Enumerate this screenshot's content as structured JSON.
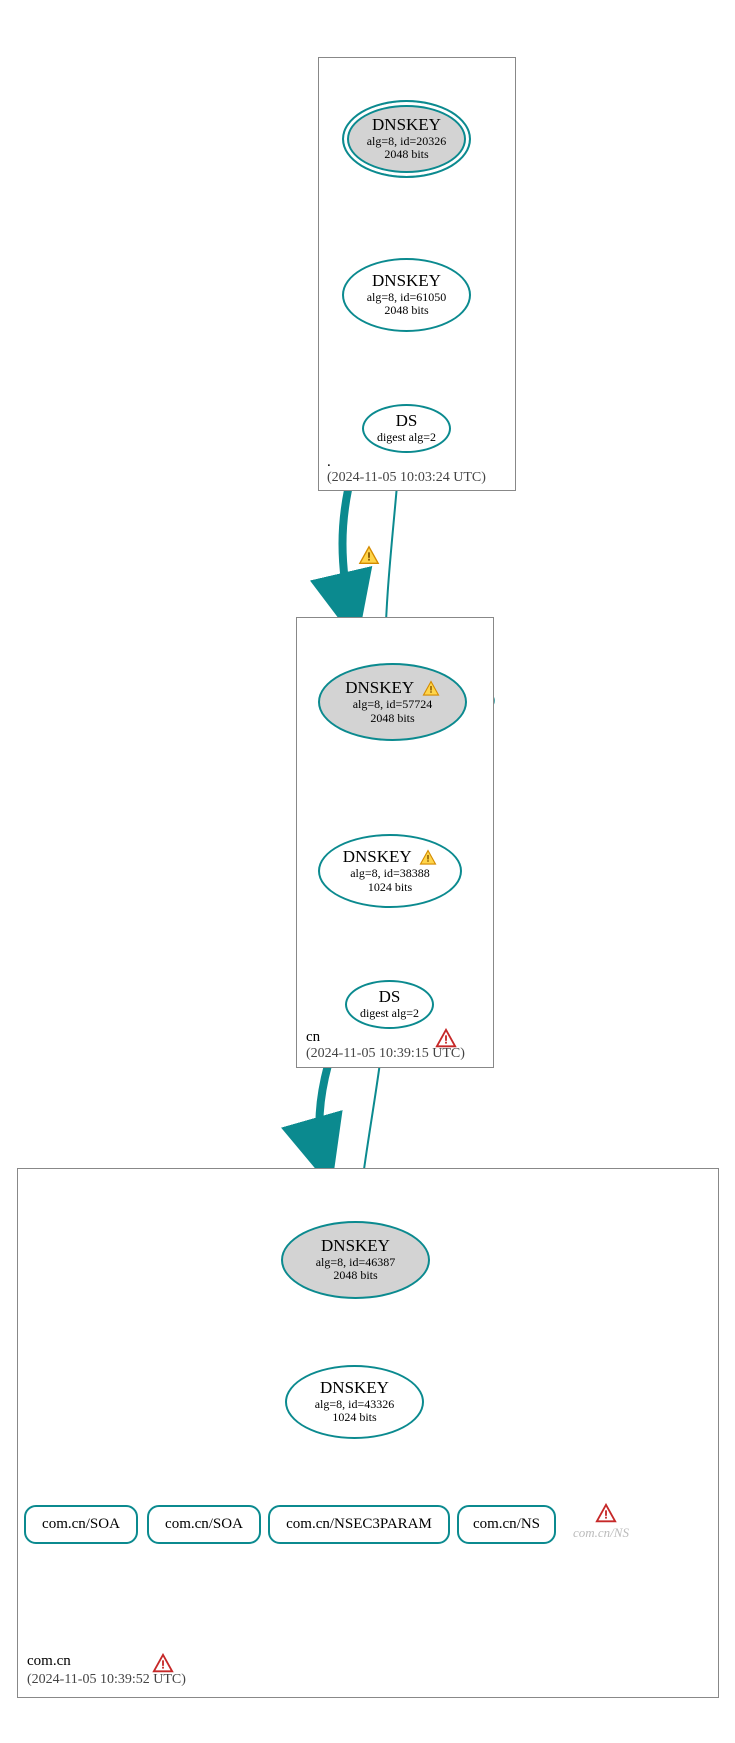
{
  "zones": {
    "root": {
      "name": ".",
      "time": "(2024-11-05 10:03:24 UTC)"
    },
    "cn": {
      "name": "cn",
      "time": "(2024-11-05 10:39:15 UTC)"
    },
    "comcn": {
      "name": "com.cn",
      "time": "(2024-11-05 10:39:52 UTC)"
    }
  },
  "nodes": {
    "root_ksk": {
      "title": "DNSKEY",
      "line1": "alg=8, id=20326",
      "line2": "2048 bits"
    },
    "root_zsk": {
      "title": "DNSKEY",
      "line1": "alg=8, id=61050",
      "line2": "2048 bits"
    },
    "root_ds": {
      "title": "DS",
      "line1": "digest alg=2"
    },
    "cn_ksk": {
      "title": "DNSKEY",
      "line1": "alg=8, id=57724",
      "line2": "2048 bits"
    },
    "cn_zsk": {
      "title": "DNSKEY",
      "line1": "alg=8, id=38388",
      "line2": "1024 bits"
    },
    "cn_ds": {
      "title": "DS",
      "line1": "digest alg=2"
    },
    "comcn_ksk": {
      "title": "DNSKEY",
      "line1": "alg=8, id=46387",
      "line2": "2048 bits"
    },
    "comcn_zsk": {
      "title": "DNSKEY",
      "line1": "alg=8, id=43326",
      "line2": "1024 bits"
    }
  },
  "rrsets": {
    "soa1": "com.cn/SOA",
    "soa2": "com.cn/SOA",
    "nsec3": "com.cn/NSEC3PARAM",
    "ns": "com.cn/NS",
    "ns_err": "com.cn/NS"
  }
}
